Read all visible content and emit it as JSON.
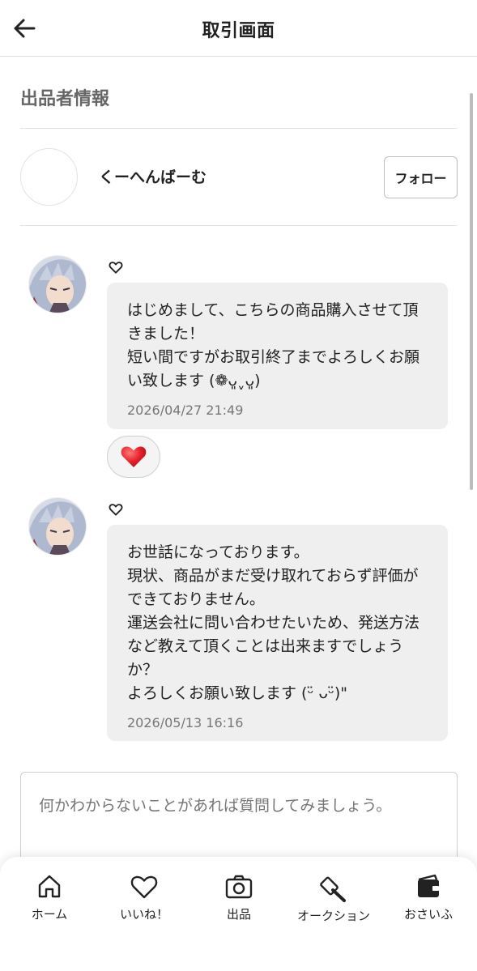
{
  "header": {
    "title": "取引画面",
    "back_icon": "back-arrow-icon"
  },
  "seller": {
    "section_title": "出品者情報",
    "name": "くーへんばーむ",
    "follow_label": "フォロー"
  },
  "messages": [
    {
      "text": "はじめまして、こちらの商品購入させて頂きました！\n短い間ですがお取引終了までよろしくお願い致します (❁ᴗ͈ˬᴗ͈)",
      "time": "2026/04/27 21:49",
      "reaction": "heart"
    },
    {
      "text": "お世話になっております。\n現状、商品がまだ受け取れておらず評価ができておりません。\n運送会社に問い合わせたいため、発送方法など教えて頂くことは出来ますでしょうか？\nよろしくお願い致します (ᵕ̈ ᴗᵕ̈)\"",
      "time": "2026/05/13 16:16"
    }
  ],
  "input": {
    "placeholder": "何かわからないことがあれば質問してみましょう。"
  },
  "nav": [
    {
      "label": "ホーム",
      "icon": "home-icon"
    },
    {
      "label": "いいね！",
      "icon": "heart-icon"
    },
    {
      "label": "出品",
      "icon": "camera-icon"
    },
    {
      "label": "オークション",
      "icon": "gavel-icon"
    },
    {
      "label": "おさいふ",
      "icon": "wallet-icon"
    }
  ],
  "colors": {
    "reaction_heart": "#e8212b",
    "bubble_bg": "#efefef"
  }
}
